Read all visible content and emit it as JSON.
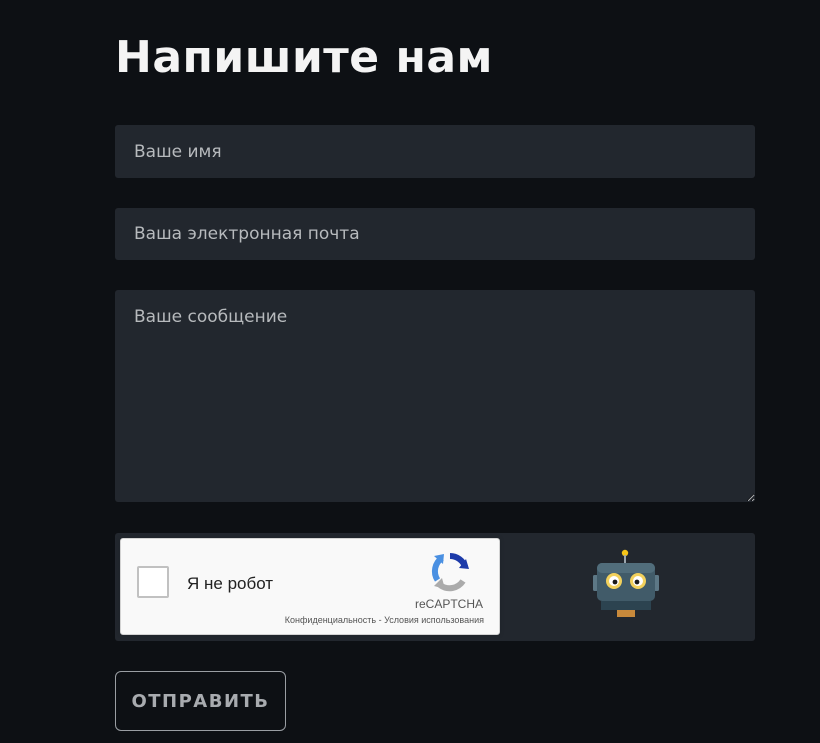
{
  "page": {
    "title": "Напишите нам"
  },
  "form": {
    "name_placeholder": "Ваше имя",
    "email_placeholder": "Ваша электронная почта",
    "message_placeholder": "Ваше сообщение",
    "submit_label": "ОТПРАВИТЬ"
  },
  "recaptcha": {
    "checkbox_label": "Я не робот",
    "checked": false,
    "brand": "reCAPTCHA",
    "privacy_link": "Конфиденциальность",
    "separator": " - ",
    "terms_link": "Условия использования",
    "logo_icon": "recaptcha-logo-icon"
  },
  "decor": {
    "robot_icon": "robot-icon"
  },
  "colors": {
    "background": "#0d1014",
    "field_background": "#22272e",
    "button_border": "#9a9ea3",
    "recaptcha_blue": "#1c3aa9",
    "recaptcha_light_blue": "#4a90e2",
    "recaptcha_gray": "#ababab"
  }
}
